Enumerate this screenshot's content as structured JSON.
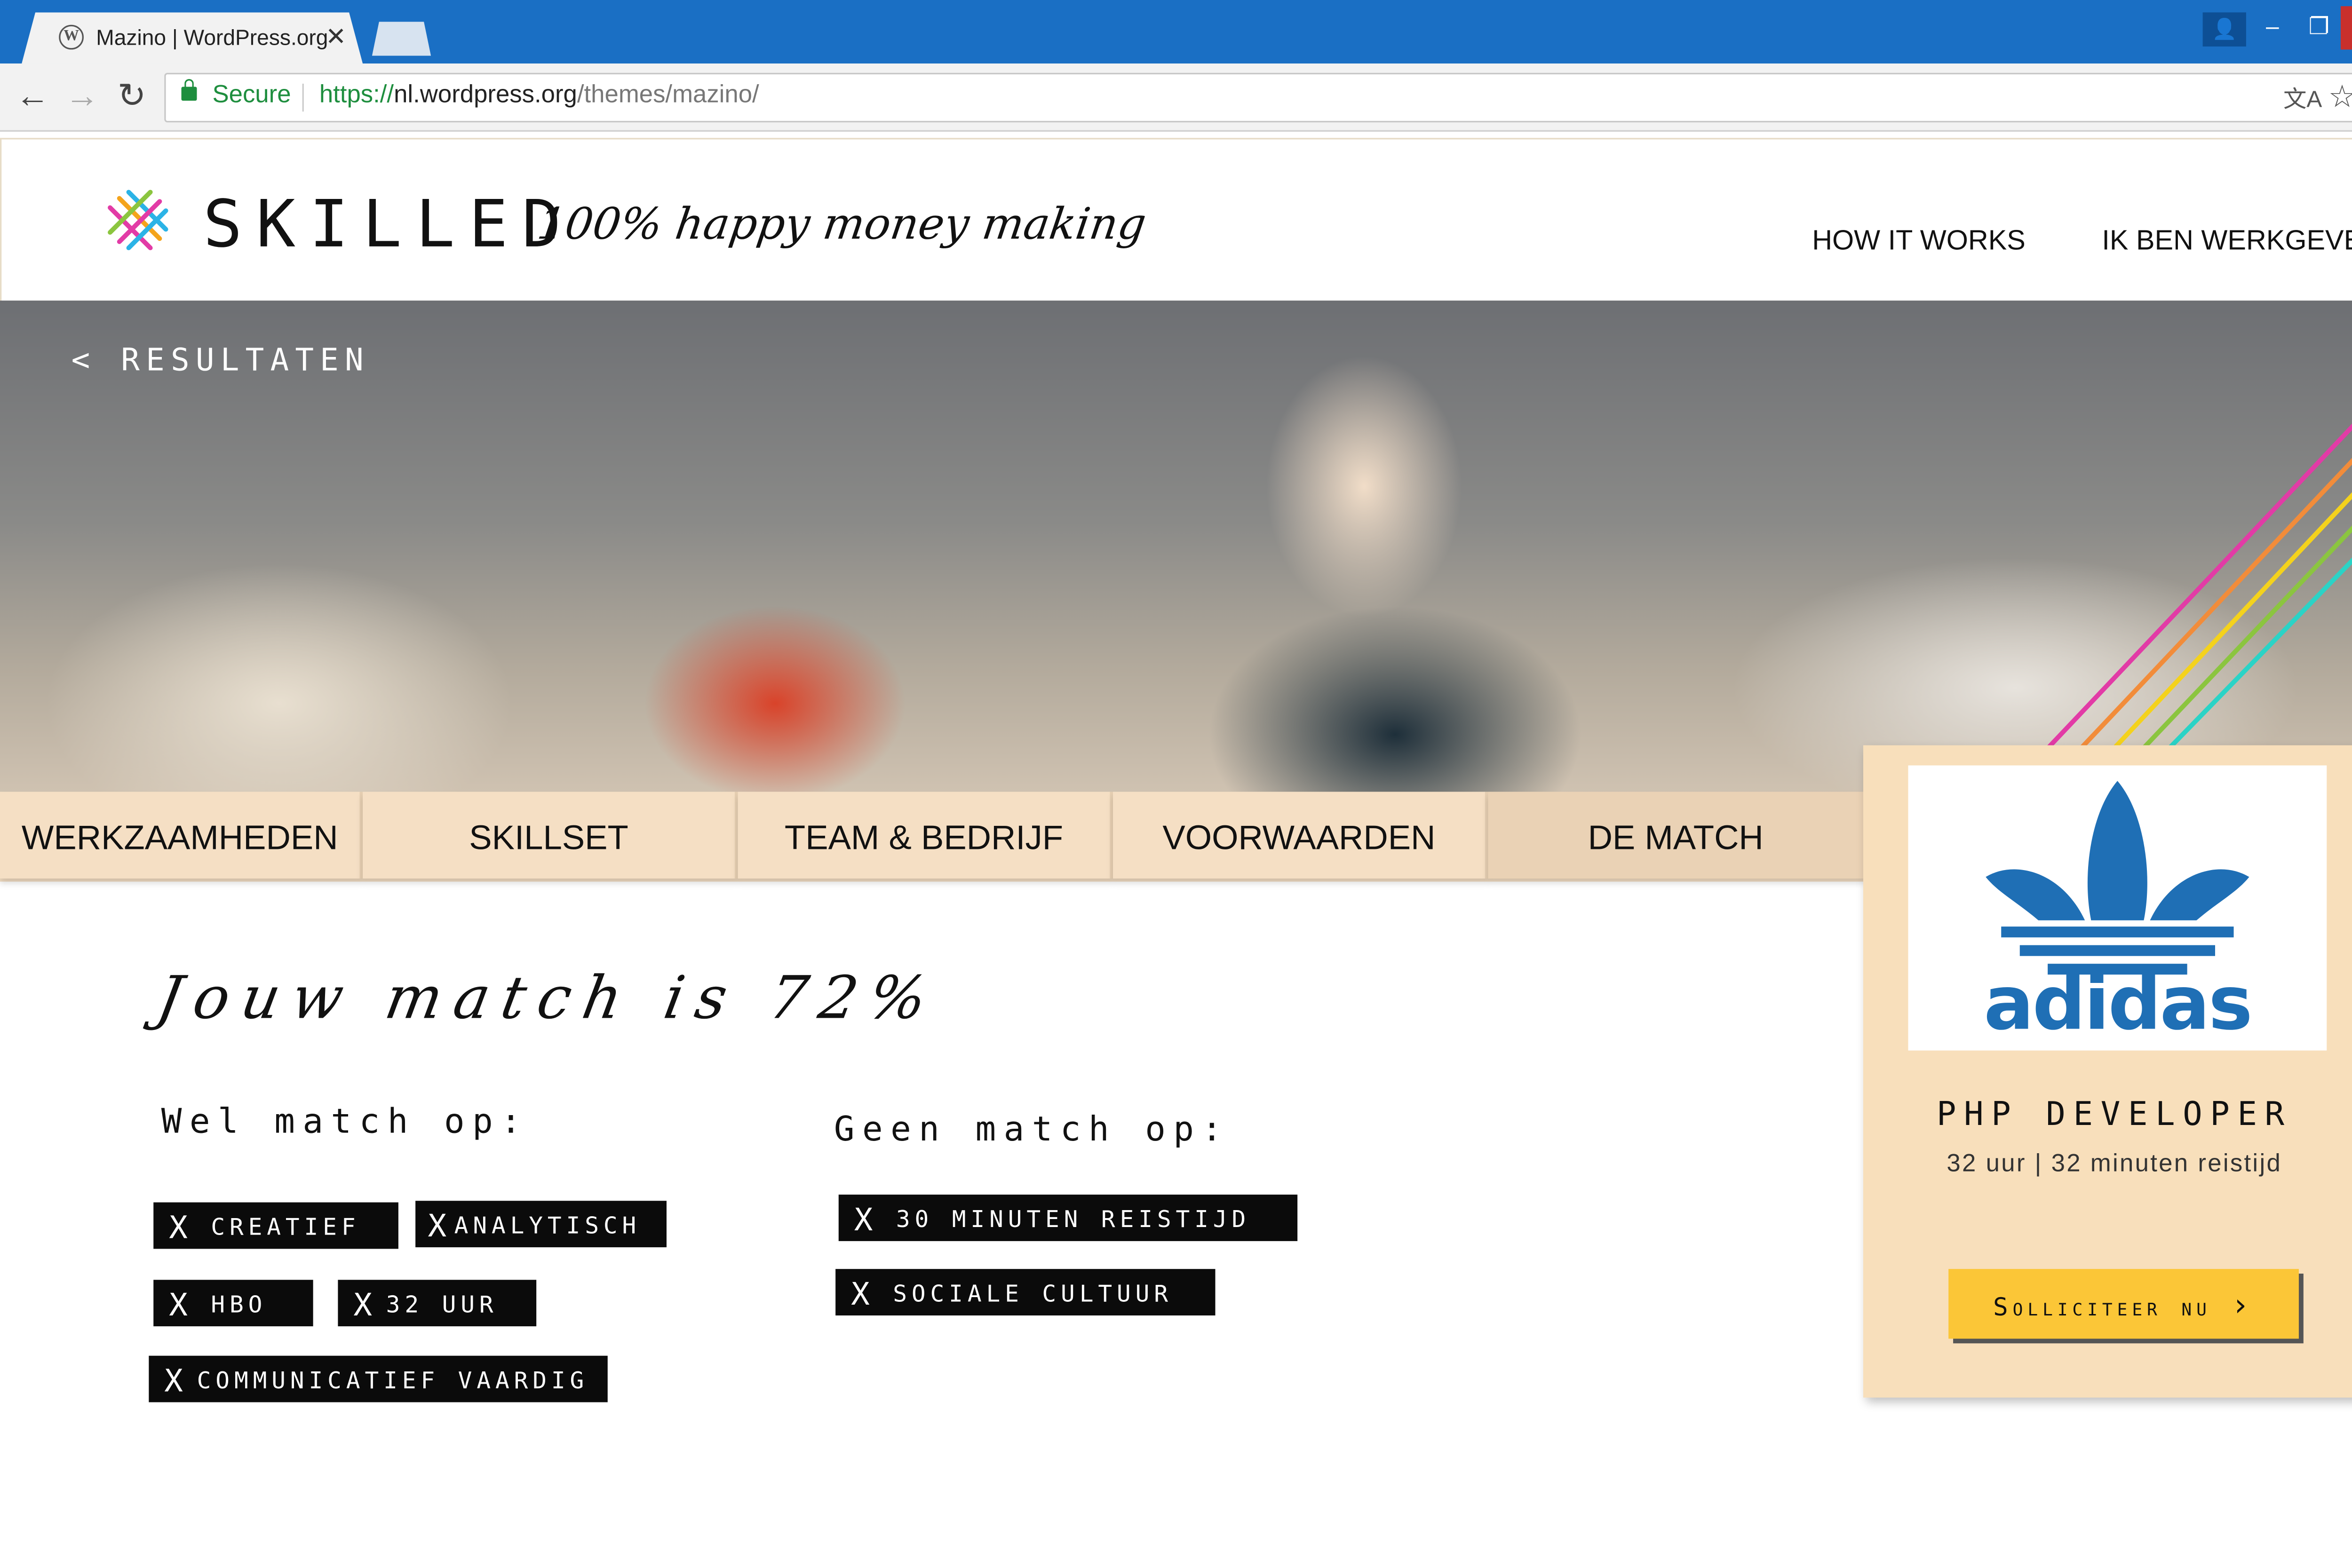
{
  "browser": {
    "tab_title": "Mazino | WordPress.org",
    "tab_close": "✕",
    "secure_label": "Secure",
    "url_scheme": "https://",
    "url_host": "nl.wordpress.org",
    "url_path": "/themes/mazino/",
    "window_controls": {
      "minimize": "–",
      "restore": "❐",
      "close": "✕"
    }
  },
  "site": {
    "logo_text": "SKILLED",
    "tagline": "100% happy money making",
    "nav": [
      "HOW IT WORKS",
      "IK BEN WERKGEVER"
    ]
  },
  "hero": {
    "back_link": "< RESULTATEN"
  },
  "tabs": [
    {
      "label": "WERKZAAMHEDEN"
    },
    {
      "label": "SKILLSET"
    },
    {
      "label": "TEAM & BEDRIJF"
    },
    {
      "label": "VOORWAARDEN"
    },
    {
      "label": "DE MATCH"
    }
  ],
  "match": {
    "title": "Jouw match is 72%",
    "match_percent": 72,
    "wel_heading": "Wel match op:",
    "geen_heading": "Geen match op:",
    "wel_tags": [
      "CREATIEF",
      "ANALYTISCH",
      "HBO",
      "32 UUR",
      "COMMUNICATIEF VAARDIG"
    ],
    "geen_tags": [
      "30 MINUTEN REISTIJD",
      "SOCIALE CULTUUR"
    ],
    "tag_marker": "X"
  },
  "job_card": {
    "company": "adidas",
    "title": "PHP DEVELOPER",
    "subtitle": "32 uur | 32 minuten reistijd",
    "apply_label": "Solliciteer nu",
    "apply_arrow": "›"
  },
  "colors": {
    "chrome_blue": "#1a6fc4",
    "tab_bg": "#f5dfc4",
    "card_bg": "#f8dfbb",
    "apply_yellow": "#fbc637",
    "adidas_blue": "#1f6fb5",
    "tag_black": "#0b0b0b"
  }
}
